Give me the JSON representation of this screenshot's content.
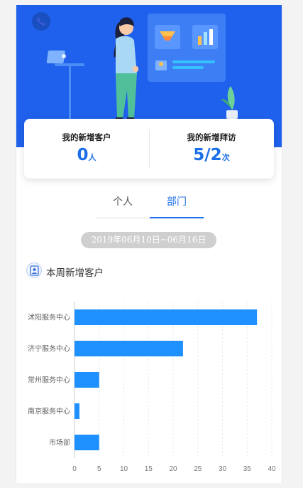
{
  "hero": {
    "colors": {
      "background": "#1f61ec",
      "panel": "#3d7ef5"
    }
  },
  "stats": {
    "customers": {
      "label": "我的新增客户",
      "value": "0",
      "unit": "人"
    },
    "visits": {
      "label": "我的新增拜访",
      "value": "5/2",
      "unit": "次"
    }
  },
  "tabs": [
    {
      "label": "个人",
      "active": false
    },
    {
      "label": "部门",
      "active": true
    }
  ],
  "date_range": "2019年06月10日~06月16日",
  "section": {
    "title": "本周新增客户",
    "icon": "customer-card-icon"
  },
  "colors": {
    "accent": "#1a6fe8",
    "bar": "#1e90ff",
    "tab_active": "#1a6fe8"
  },
  "chart_data": {
    "type": "bar",
    "orientation": "horizontal",
    "categories": [
      "沭阳服务中心",
      "济宁服务中心",
      "常州服务中心",
      "南京服务中心",
      "市场部"
    ],
    "values": [
      37,
      22,
      5,
      1,
      5
    ],
    "xlim": [
      0,
      40
    ],
    "xticks": [
      0,
      5,
      10,
      15,
      20,
      25,
      30,
      35,
      40
    ],
    "grid": "dashed-vertical",
    "title": "",
    "xlabel": "",
    "ylabel": ""
  }
}
